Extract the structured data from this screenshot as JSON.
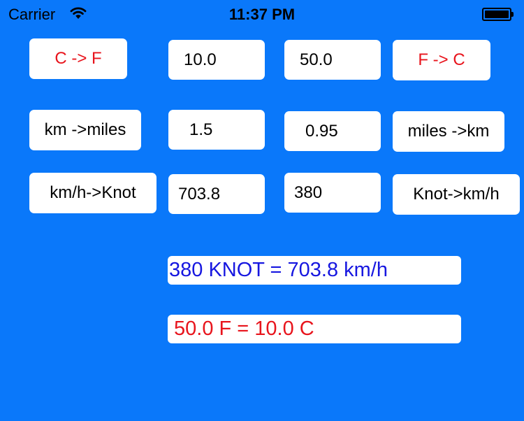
{
  "status_bar": {
    "carrier": "Carrier",
    "wifi_icon": "wifi-icon",
    "time": "11:37 PM",
    "battery_icon": "battery-icon"
  },
  "temperature": {
    "c_to_f_label": "C -> F",
    "celsius_value": "10.0",
    "fahrenheit_value": "50.0",
    "f_to_c_label": "F -> C"
  },
  "distance": {
    "km_to_miles_label": "km ->miles",
    "km_value": "1.5",
    "miles_value": "0.95",
    "miles_to_km_label": "miles ->km"
  },
  "speed": {
    "kmh_to_knot_label": "km/h->Knot",
    "kmh_value": "703.8",
    "knot_value": "380",
    "knot_to_kmh_label": "Knot->km/h"
  },
  "results": {
    "speed_result": "380 KNOT = 703.8 km/h",
    "temperature_result": "50.0 F =  10.0 C"
  },
  "colors": {
    "background": "#0a78fa",
    "temperature_accent": "#e8141c",
    "speed_result_text": "#1717e0"
  }
}
